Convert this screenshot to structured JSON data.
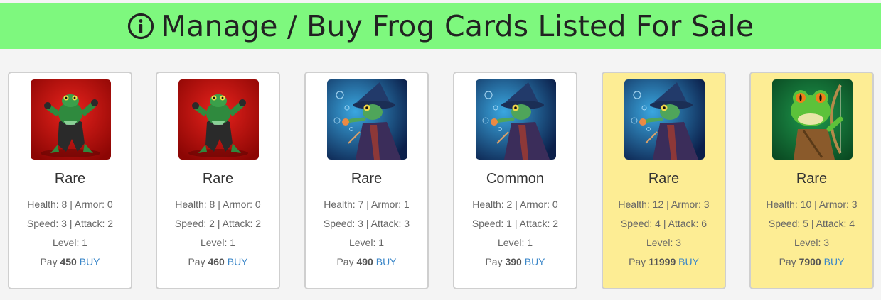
{
  "header": {
    "title": "Manage / Buy Frog Cards Listed For Sale",
    "icon": "info-circle-icon",
    "background": "#7ef87e"
  },
  "labels": {
    "health": "Health:",
    "armor": "Armor:",
    "speed": "Speed:",
    "attack": "Attack:",
    "level": "Level:",
    "pay": "Pay",
    "buy": "BUY",
    "separator": "|"
  },
  "colors": {
    "card_default": "#ffffff",
    "card_highlight": "#fded94",
    "buy_link": "#3a86c8"
  },
  "cards": [
    {
      "art": "red-fighter-frog",
      "rarity": "Rare",
      "health": "8",
      "armor": "0",
      "speed": "3",
      "attack": "2",
      "level": "1",
      "price": "450",
      "highlight": false
    },
    {
      "art": "red-fighter-frog",
      "rarity": "Rare",
      "health": "8",
      "armor": "0",
      "speed": "2",
      "attack": "2",
      "level": "1",
      "price": "460",
      "highlight": false
    },
    {
      "art": "wizard-frog",
      "rarity": "Rare",
      "health": "7",
      "armor": "1",
      "speed": "3",
      "attack": "3",
      "level": "1",
      "price": "490",
      "highlight": false
    },
    {
      "art": "wizard-frog",
      "rarity": "Common",
      "health": "2",
      "armor": "0",
      "speed": "1",
      "attack": "2",
      "level": "1",
      "price": "390",
      "highlight": false
    },
    {
      "art": "wizard-frog",
      "rarity": "Rare",
      "health": "12",
      "armor": "3",
      "speed": "4",
      "attack": "6",
      "level": "3",
      "price": "11999",
      "highlight": true
    },
    {
      "art": "archer-frog",
      "rarity": "Rare",
      "health": "10",
      "armor": "3",
      "speed": "5",
      "attack": "4",
      "level": "3",
      "price": "7900",
      "highlight": true
    }
  ]
}
